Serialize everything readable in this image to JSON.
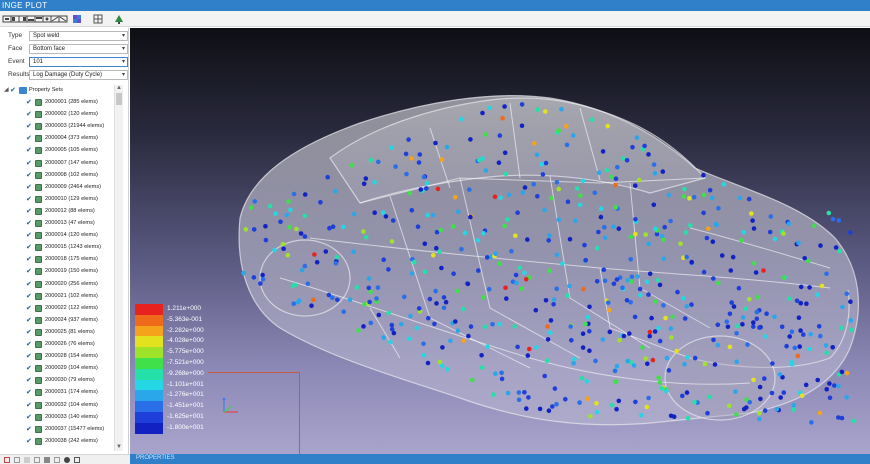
{
  "window": {
    "title": "INGE PLOT"
  },
  "toolbar": {
    "icons": [
      "nav-icon",
      "nav-icon",
      "nav-icon",
      "nav-icon",
      "nav-icon",
      "nav-icon",
      "nav-icon",
      "nav-icon",
      "nav-icon",
      "grid-icon",
      "tree-icon"
    ]
  },
  "properties": {
    "type": {
      "label": "Type",
      "value": "Spot weld"
    },
    "face": {
      "label": "Face",
      "value": "Bottom face"
    },
    "event": {
      "label": "Event",
      "value": "101"
    },
    "results": {
      "label": "Results",
      "value": "Log Damage (Duty Cycle)"
    }
  },
  "tree": {
    "root": "Property Sets",
    "items": [
      "2000001 (285 elems)",
      "2000002 (120 elems)",
      "2000003 (21944 elems)",
      "2000004 (373 elems)",
      "2000005 (105 elems)",
      "2000007 (147 elems)",
      "2000008 (102 elems)",
      "2000009 (2464 elems)",
      "2000010 (129 elems)",
      "2000012 (88 elems)",
      "2000013 (47 elems)",
      "2000014 (120 elems)",
      "2000015 (1243 elems)",
      "2000018 (175 elems)",
      "2000019 (150 elems)",
      "2000020 (256 elems)",
      "2000021 (102 elems)",
      "2000022 (122 elems)",
      "2000024 (937 elems)",
      "2000025 (81 elems)",
      "2000026 (76 elems)",
      "2000028 (154 elems)",
      "2000029 (104 elems)",
      "2000030 (79 elems)",
      "2000031 (174 elems)",
      "2000032 (104 elems)",
      "2000033 (140 elems)",
      "2000037 (15477 elems)",
      "2000038 (242 elems)"
    ]
  },
  "legend": {
    "values": [
      "1.211e+000",
      "-5.363e-001",
      "-2.282e+000",
      "-4.028e+000",
      "-5.775e+000",
      "-7.521e+000",
      "-9.268e+000",
      "-1.101e+001",
      "-1.276e+001",
      "-1.451e+001",
      "-1.625e+001",
      "-1.800e+001"
    ],
    "colors": [
      "#e8231f",
      "#f06a1c",
      "#f5a31a",
      "#e3e21e",
      "#9fe22a",
      "#3fe04a",
      "#25e0a8",
      "#25d6e3",
      "#2aa7ea",
      "#2a6ee8",
      "#1e3fd9",
      "#1222c2"
    ]
  },
  "statusbar": {
    "text": "PROPERTIES"
  },
  "colors": {
    "titlebar": "#2f7fc9",
    "statusbar": "#2f7fc9"
  }
}
